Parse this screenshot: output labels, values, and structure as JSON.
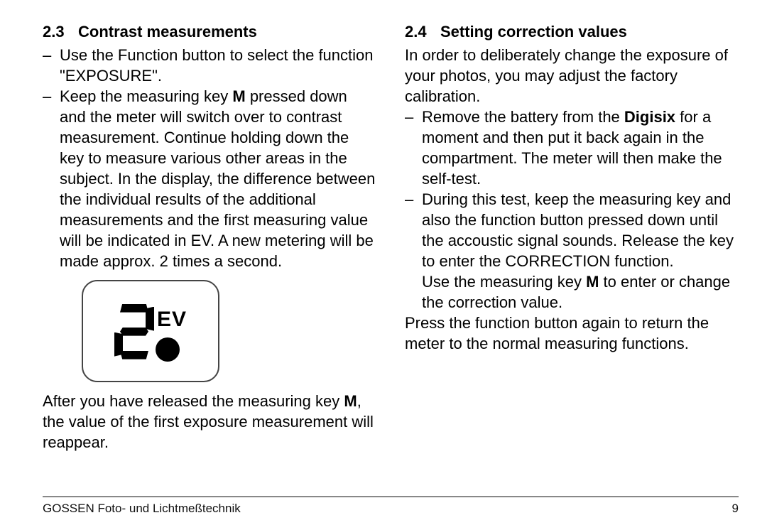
{
  "left": {
    "heading_num": "2.3",
    "heading_text": "Contrast measurements",
    "b1": "Use the Function button to select the function \"EXPOSURE\".",
    "b2a": "Keep the measuring key ",
    "b2_bold1": "M",
    "b2b": " pressed down and the meter will switch over to contrast measurement. Continue holding down the key to measure various other areas in the subject. In the display, the difference between the individual results of the additional measurements and the first measuring value will be indicated in EV. A new metering will be made approx. 2 times a second.",
    "display_label": "EV",
    "after_a": "After you have released the measuring key ",
    "after_bold": "M",
    "after_b": ", the value of the first exposure measure­ment will reappear."
  },
  "right": {
    "heading_num": "2.4",
    "heading_text": "Setting correction values",
    "intro": "In order to deliberately change the exposure of your photos, you may adjust the factory calibration.",
    "b1a": "Remove the battery from the ",
    "b1_bold": "Digisix",
    "b1b": " for a moment and then put it back again in the compartment. The meter will then make the self-test.",
    "b2": "During this test, keep the measuring key and also the function button pressed down until the accoustic signal sounds. Release the key to enter the CORRECTION function.",
    "b2c_a": "Use the measuring key ",
    "b2c_bold": "M",
    "b2c_b": " to enter or change the correction value.",
    "outro": "Press the function button again to return the meter to the normal measuring functions."
  },
  "footer": {
    "left": "GOSSEN Foto- und Lichtmeßtechnik",
    "right": "9"
  }
}
